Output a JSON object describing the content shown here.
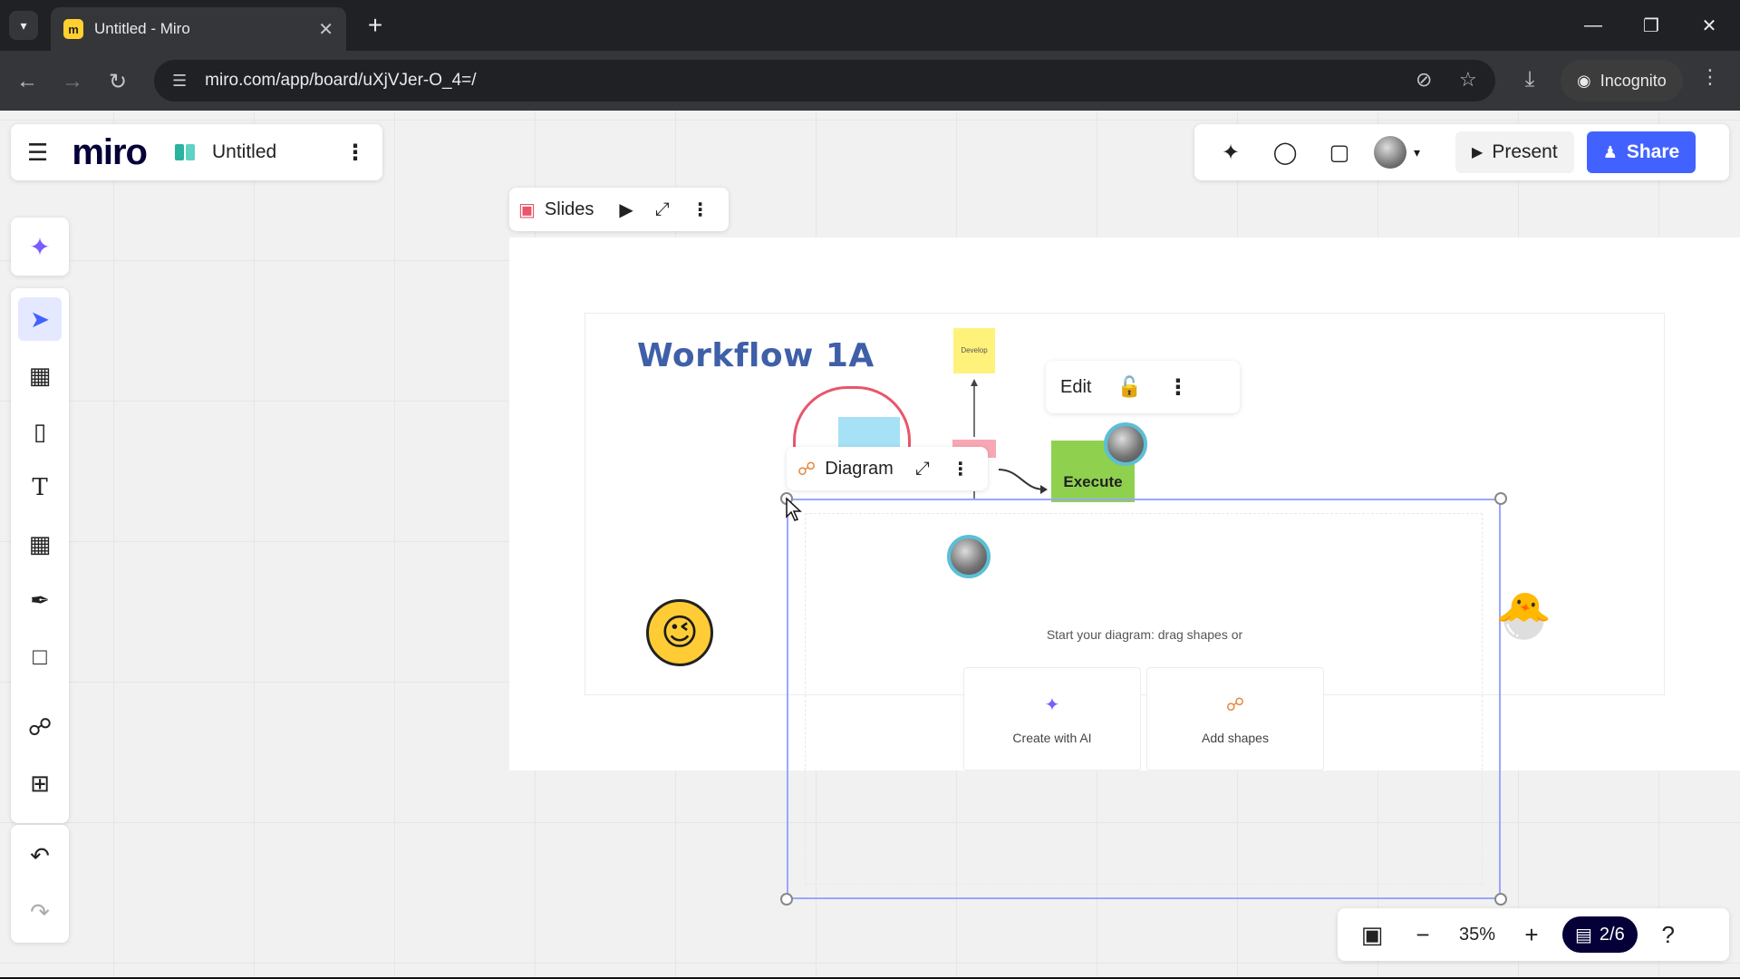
{
  "browser": {
    "tab_title": "Untitled - Miro",
    "new_tab": "+",
    "url": "miro.com/app/board/uXjVJer-O_4=/",
    "incognito_label": "Incognito",
    "icons": [
      "tab-list-icon",
      "back-icon",
      "forward-icon",
      "reload-icon",
      "site-info-icon",
      "eye-off-icon",
      "star-icon",
      "download-icon",
      "incognito-icon",
      "more-icon",
      "minimize-icon",
      "restore-icon",
      "close-icon"
    ]
  },
  "header": {
    "logo": "miro",
    "board_title": "Untitled"
  },
  "topright": {
    "present_label": "Present",
    "share_label": "Share",
    "accent_color": "#4262ff"
  },
  "frame_toolbar": {
    "slides_label": "Slides"
  },
  "board": {
    "title": "Workflow 1A",
    "sticky_text": "Develop",
    "execute_label": "Execute",
    "edit_label": "Edit",
    "diagram_label": "Diagram",
    "diagram_prompt": "Start your diagram: drag shapes or",
    "create_ai_label": "Create with AI",
    "add_shapes_label": "Add shapes"
  },
  "bottom": {
    "zoom": "35%",
    "pages": "2/6"
  }
}
